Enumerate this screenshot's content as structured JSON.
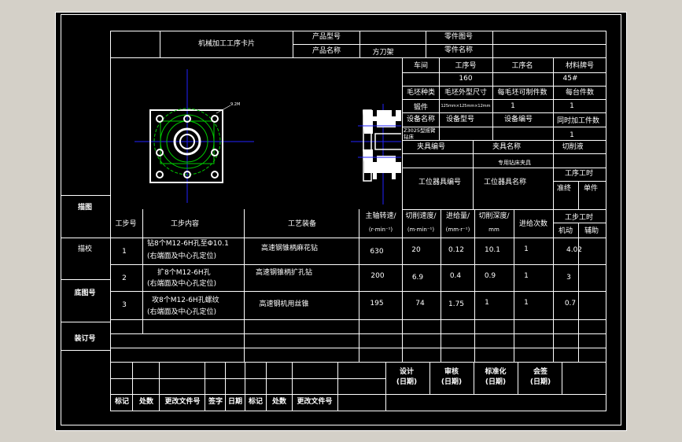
{
  "header": {
    "card_title": "机械加工工序卡片",
    "product_model_label": "产品型号",
    "part_drawing_no_label": "零件图号",
    "product_name_label": "产品名称",
    "product_name_value": "方刀架",
    "part_name_label": "零件名称"
  },
  "info": {
    "workshop_label": "车间",
    "process_no_label": "工序号",
    "process_name_label": "工序名",
    "material_label": "材料牌号",
    "process_no_value": "160",
    "material_value": "45#",
    "blank_type_label": "毛坯种类",
    "blank_size_label": "毛坯外型尺寸",
    "parts_per_blank_label": "每毛坯可制件数",
    "parts_per_machine_label": "每台件数",
    "blank_type_value": "锻件",
    "blank_size_value": "125mm×125mm×12mm",
    "parts_per_blank_value": "1",
    "parts_per_machine_value": "1",
    "equipment_name_label": "设备名称",
    "equipment_model_label": "设备型号",
    "equipment_no_label": "设备编号",
    "simultaneous_label": "同时加工件数",
    "equipment_name_value": "Z3025型摇臂钻床",
    "simultaneous_value": "1",
    "fixture_no_label": "夹具编号",
    "fixture_name_label": "夹具名称",
    "coolant_label": "切削液",
    "fixture_name_value": "专用钻床夹具",
    "station_tool_no_label": "工位器具编号",
    "station_tool_name_label": "工位器具名称",
    "process_time_label": "工序工时",
    "prep_end_label": "准终",
    "unit_label": "单件"
  },
  "sidebar": {
    "trace_drawing": "描图",
    "trace_check": "描校",
    "base_drawing_no": "底图号",
    "binding_no": "装订号"
  },
  "steps_header": {
    "step_no": "工步号",
    "step_content": "工步内容",
    "process_equipment": "工艺装备",
    "spindle_speed": "主轴转速/",
    "spindle_speed_unit": "(r·min⁻¹)",
    "cutting_speed": "切削速度/",
    "cutting_speed_unit": "(m·min⁻¹)",
    "feed": "进给量/",
    "feed_unit": "(mm·r⁻¹)",
    "depth": "切削深度/",
    "depth_unit": "mm",
    "passes": "进给次数",
    "step_time": "工步工时",
    "machine_time": "机动",
    "aux_time": "辅助"
  },
  "steps": [
    {
      "no": "1",
      "content_1": "钻8个M12-6H孔至Φ10.1",
      "content_2": "(右端面及中心孔定位)",
      "equipment": "高速钢锥柄麻花钻",
      "speed": "630",
      "cutting_speed": "20",
      "feed": "0.12",
      "depth": "10.1",
      "passes": "1",
      "machine_time": "4.02"
    },
    {
      "no": "2",
      "content_1": "扩8个M12-6H孔",
      "content_2": "(右端面及中心孔定位)",
      "equipment": "高速钢锥柄扩孔钻",
      "speed": "200",
      "cutting_speed": "6.9",
      "feed": "0.4",
      "depth": "0.9",
      "passes": "1",
      "machine_time": "3"
    },
    {
      "no": "3",
      "content_1": "攻8个M12-6H孔螺纹",
      "content_2": "(右端面及中心孔定位)",
      "equipment": "高速钢机用丝锥",
      "speed": "195",
      "cutting_speed": "74",
      "feed": "1.75",
      "depth": "1",
      "passes": "1",
      "machine_time": "0.7"
    }
  ],
  "signoff": {
    "design": "设计",
    "review": "审核",
    "standardize": "标准化",
    "countersign": "会签",
    "date": "(日期)"
  },
  "revision": {
    "mark": "标记",
    "count": "处数",
    "change_doc_no": "更改文件号",
    "signature": "签字",
    "date": "日期"
  },
  "drawing": {
    "note_label": "9.2M"
  },
  "colors": {
    "background": "#d4d0c8",
    "sheet": "#000000",
    "lines": "#ffffff",
    "centerlines": "#2222ff",
    "construction": "#00cc00"
  }
}
